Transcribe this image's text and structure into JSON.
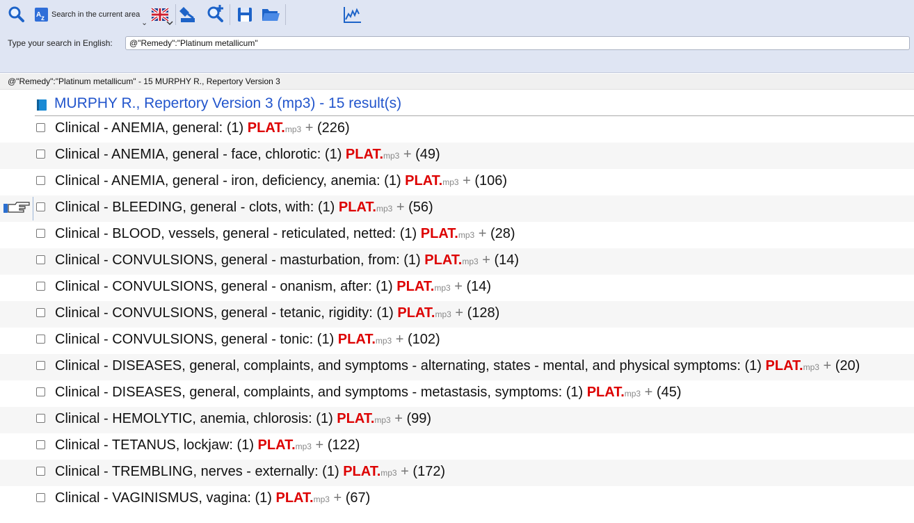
{
  "toolbar": {
    "search_area_label": "Search in the current area",
    "chevron": "⌄"
  },
  "search": {
    "label": "Type your search in English:",
    "value": "@\"Remedy\":\"Platinum metallicum\""
  },
  "results_header": "@\"Remedy\":\"Platinum metallicum\"  - 15 MURPHY R., Repertory Version 3",
  "book": {
    "title": "MURPHY R., Repertory Version 3 (mp3) - 15 result(s)",
    "color": "#2255cc"
  },
  "remedy_color": "#dd0000",
  "rubrics": [
    {
      "rubric": "Clinical - ANEMIA, general: (1) ",
      "remedy": "PLAT.",
      "source": "mp3",
      "plus": " + ",
      "count": "(226)"
    },
    {
      "rubric": "Clinical - ANEMIA, general - face, chlorotic: (1) ",
      "remedy": "PLAT.",
      "source": "mp3",
      "plus": " + ",
      "count": "(49)"
    },
    {
      "rubric": "Clinical - ANEMIA, general - iron, deficiency, anemia: (1) ",
      "remedy": "PLAT.",
      "source": "mp3",
      "plus": " + ",
      "count": "(106)"
    },
    {
      "rubric": "Clinical - BLEEDING, general - clots, with: (1) ",
      "remedy": "PLAT.",
      "source": "mp3",
      "plus": " + ",
      "count": "(56)"
    },
    {
      "rubric": "Clinical - BLOOD, vessels, general - reticulated, netted: (1) ",
      "remedy": "PLAT.",
      "source": "mp3",
      "plus": " + ",
      "count": "(28)"
    },
    {
      "rubric": "Clinical - CONVULSIONS, general - masturbation, from: (1) ",
      "remedy": "PLAT.",
      "source": "mp3",
      "plus": " + ",
      "count": "(14)"
    },
    {
      "rubric": "Clinical - CONVULSIONS, general - onanism, after: (1) ",
      "remedy": "PLAT.",
      "source": "mp3",
      "plus": " + ",
      "count": "(14)"
    },
    {
      "rubric": "Clinical - CONVULSIONS, general - tetanic, rigidity: (1) ",
      "remedy": "PLAT.",
      "source": "mp3",
      "plus": " + ",
      "count": "(128)"
    },
    {
      "rubric": "Clinical - CONVULSIONS, general - tonic: (1) ",
      "remedy": "PLAT.",
      "source": "mp3",
      "plus": " + ",
      "count": "(102)"
    },
    {
      "rubric": "Clinical - DISEASES, general, complaints, and symptoms - alternating, states - mental, and physical symptoms: (1) ",
      "remedy": "PLAT.",
      "source": "mp3",
      "plus": " + ",
      "count": "(20)"
    },
    {
      "rubric": "Clinical - DISEASES, general, complaints, and symptoms - metastasis, symptoms: (1) ",
      "remedy": "PLAT.",
      "source": "mp3",
      "plus": " + ",
      "count": "(45)"
    },
    {
      "rubric": "Clinical - HEMOLYTIC, anemia, chlorosis: (1) ",
      "remedy": "PLAT.",
      "source": "mp3",
      "plus": " + ",
      "count": "(99)"
    },
    {
      "rubric": "Clinical - TETANUS, lockjaw: (1) ",
      "remedy": "PLAT.",
      "source": "mp3",
      "plus": " + ",
      "count": "(122)"
    },
    {
      "rubric": "Clinical - TREMBLING, nerves - externally: (1) ",
      "remedy": "PLAT.",
      "source": "mp3",
      "plus": " + ",
      "count": "(172)"
    },
    {
      "rubric": "Clinical - VAGINISMUS, vagina: (1) ",
      "remedy": "PLAT.",
      "source": "mp3",
      "plus": " + ",
      "count": "(67)"
    }
  ],
  "pointer_row": 3,
  "icons": [
    "search-icon",
    "az-search-icon",
    "uk-flag-icon",
    "clipboard-icon",
    "zoom-add-icon",
    "save-icon",
    "open-folder-icon",
    "chart-icon",
    "book-icon",
    "pointing-hand-icon"
  ]
}
